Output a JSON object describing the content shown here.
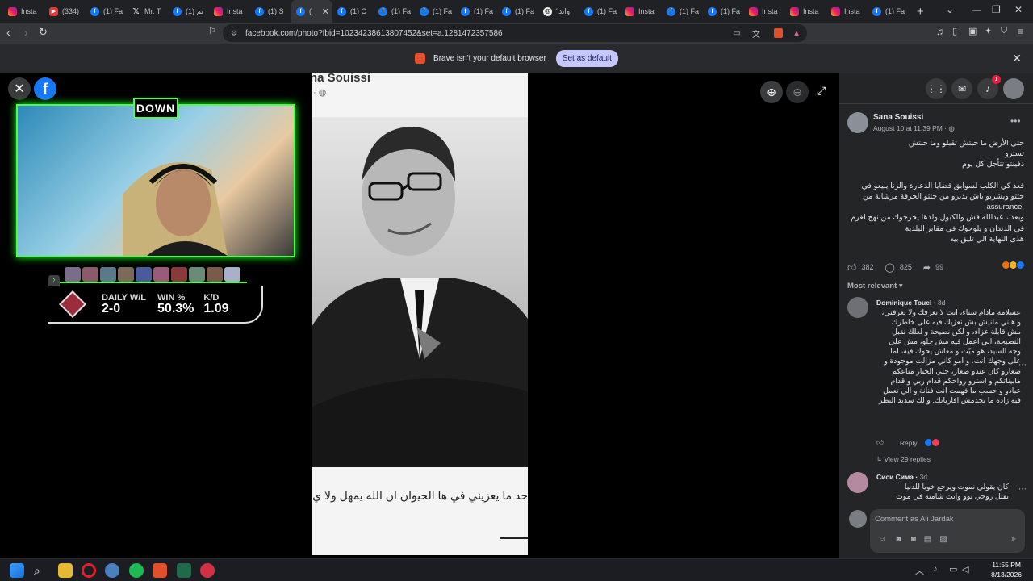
{
  "browser": {
    "tabs": [
      {
        "icon": "instagram-icon",
        "title": "Insta"
      },
      {
        "icon": "youtube-icon",
        "title": "(334)"
      },
      {
        "icon": "facebook-icon",
        "title": "(1) Fa"
      },
      {
        "icon": "x-icon",
        "title": "Mr. T"
      },
      {
        "icon": "facebook-icon",
        "title": "(1) تم"
      },
      {
        "icon": "instagram-icon",
        "title": "Insta"
      },
      {
        "icon": "facebook-icon",
        "title": "(1) S"
      },
      {
        "icon": "facebook-icon",
        "title": "(",
        "active": true
      },
      {
        "icon": "facebook-icon",
        "title": "(1) C"
      },
      {
        "icon": "facebook-icon",
        "title": "(1) Fa"
      },
      {
        "icon": "facebook-icon",
        "title": "(1) Fa"
      },
      {
        "icon": "facebook-icon",
        "title": "(1) Fa"
      },
      {
        "icon": "facebook-icon",
        "title": "(1) Fa"
      },
      {
        "icon": "threads-icon",
        "title": "\"واند"
      },
      {
        "icon": "facebook-icon",
        "title": "(1) Fa"
      },
      {
        "icon": "instagram-icon",
        "title": "Insta"
      },
      {
        "icon": "facebook-icon",
        "title": "(1) Fa"
      },
      {
        "icon": "facebook-icon",
        "title": "(1) Fa"
      },
      {
        "icon": "instagram-icon",
        "title": "Insta"
      },
      {
        "icon": "instagram-icon",
        "title": "Insta"
      },
      {
        "icon": "instagram-icon",
        "title": "Insta"
      },
      {
        "icon": "facebook-icon",
        "title": "(1) Fa"
      }
    ],
    "new_tab": "+",
    "url": "facebook.com/photo?fbid=10234238613807452&set=a.1281472357586",
    "banner_text": "Brave isn't your default browser",
    "banner_button": "Set as default"
  },
  "stream_overlay": {
    "badge": "DOWN",
    "stats": [
      {
        "label": "DAILY W/L",
        "value": "2-0"
      },
      {
        "label": "WIN %",
        "value": "50.3%"
      },
      {
        "label": "K/D",
        "value": "1.09"
      }
    ]
  },
  "photo": {
    "visible_name": "na Souissi",
    "caption": "حد ما يعزيني في ها الحيوان ان الله يمهل ولا ي"
  },
  "panel": {
    "notification_count": "1",
    "post": {
      "author": "Sana Souissi",
      "date": "August 10 at 11:39 PM ·",
      "text": "حتي الأرض ما حبتش تقبلو وما حبتش\nتسترو\nدفينتو تتأجل كل يوم\n\nقعد كي الكلب لسوابق قضايا الدعارة والزنا يبيعو في\nجثتو ويشربو باش يدبرو من جثتو الحرفة مرشانة من\n.assurance\nوبعد ، عبدالله فش والكبول ولدها يخرجوك من نهج لغرم\nفي الدندان و يلوحوك في مقابر البلدية\nهذى النهاية الي تليق بيه",
      "likes": "382",
      "comments": "825",
      "shares": "99"
    },
    "sort_label": "Most relevant",
    "comments": [
      {
        "author": "Dominique Touel",
        "time": "3d",
        "text": "عسلامة مادام سناء، انت لا تعرفك ولا تعرفني، و هاني مانيش بش نعزيك فيه على خاطرك مش قابلة عزاء، و لكن نصيحة و لعلك تقبل النصيحة، الي اعمل فيه مش حلو، مش على وجه السيد، هو ميّت و معاش يحوك فيه، اما على وجهك انت، و امو كاني مزالت موجودة و صغارو كان عندو صغار، خلي الخنار متاعكم مابيناتكم و استرو رواحكم قدام ربي و قدام عبادو و حسب ما فهمت انت فنانة و الي تعمل فيه زادة ما يخدمش افارياتك. و لك سديد النظر",
        "reply_label": "Reply",
        "view_replies": "View 29 replies"
      },
      {
        "author": "Сиси Сима",
        "time": "3d",
        "text": "كان يقولي نموت ويرجع خويا للدنيا نقتل روحي نوو وانت شامتة في موت"
      }
    ],
    "comment_placeholder": "Comment as Ali Jardak"
  },
  "taskbar": {
    "time": "11:55 PM",
    "date": "8/13/2026"
  }
}
